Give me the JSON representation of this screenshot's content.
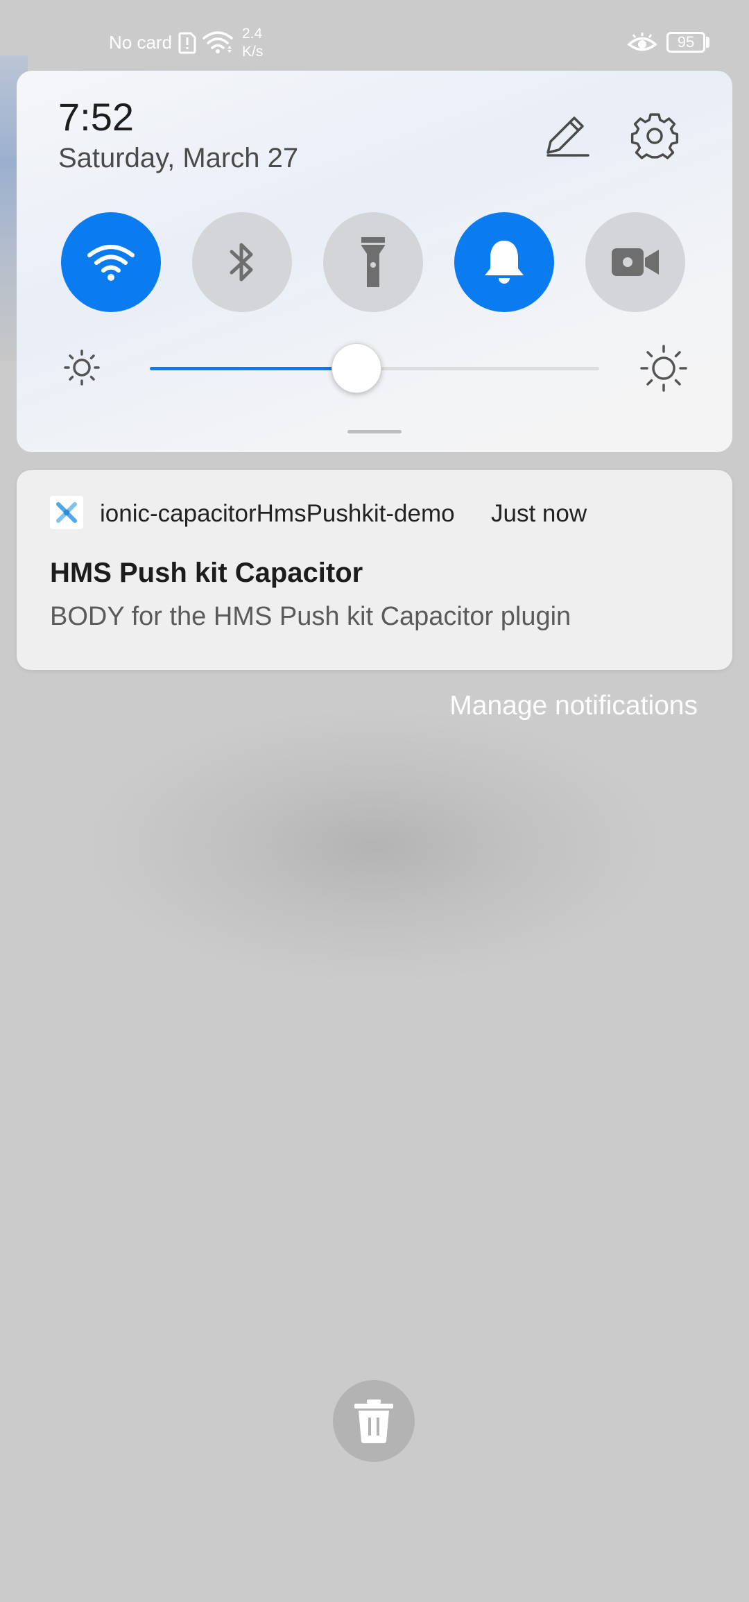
{
  "status_bar": {
    "carrier": "No card",
    "speed_value": "2.4",
    "speed_unit": "K/s",
    "battery": "95",
    "icons": [
      "sim-alert-icon",
      "wifi-icon",
      "eye-comfort-icon",
      "battery-icon"
    ]
  },
  "quick_settings": {
    "time": "7:52",
    "date": "Saturday, March 27",
    "actions": [
      "edit-icon",
      "settings-icon"
    ],
    "tiles": [
      {
        "icon": "wifi-icon",
        "state": "on"
      },
      {
        "icon": "bluetooth-icon",
        "state": "off"
      },
      {
        "icon": "flashlight-icon",
        "state": "off"
      },
      {
        "icon": "bell-icon",
        "state": "on"
      },
      {
        "icon": "video-camera-icon",
        "state": "off"
      }
    ],
    "brightness_level": 0.46,
    "accent_color": "#0a7cf0"
  },
  "notification": {
    "app_name": "ionic-capacitorHmsPushkit-demo",
    "time": "Just now",
    "title": "HMS Push kit Capacitor",
    "body": "BODY for the HMS Push kit Capacitor plugin"
  },
  "manage_label": "Manage notifications",
  "clear_all_icon": "trash-icon"
}
